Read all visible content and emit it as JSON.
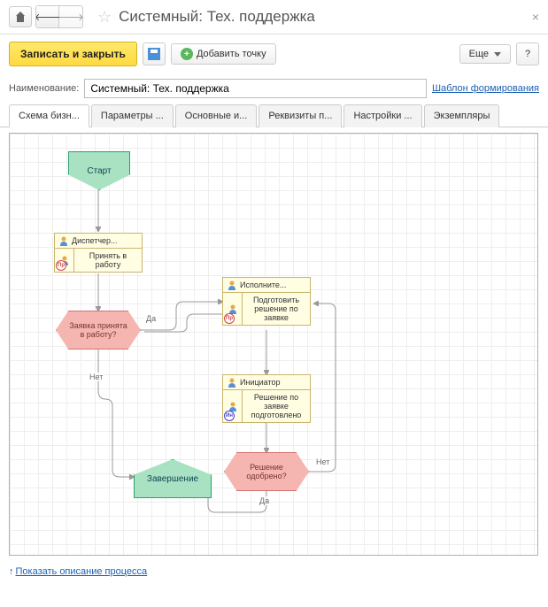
{
  "title": "Системный: Тех. поддержка",
  "toolbar": {
    "save_close": "Записать и закрыть",
    "add_point": "Добавить точку",
    "more": "Еще",
    "help": "?"
  },
  "form": {
    "name_label": "Наименование:",
    "name_value": "Системный: Тех. поддержка",
    "template_link": "Шаблон формирования"
  },
  "tabs": [
    "Схема бизн...",
    "Параметры ...",
    "Основные и...",
    "Реквизиты п...",
    "Настройки ...",
    "Экземпляры"
  ],
  "active_tab": 0,
  "diagram": {
    "start": "Старт",
    "end": "Завершение",
    "task1_role": "Диспетчер...",
    "task1_text": "Принять в работу",
    "task2_role": "Исполните...",
    "task2_text": "Подготовить решение по заявке",
    "task3_role": "Инициатор",
    "task3_text": "Решение по заявке подготовлено",
    "dec1": "Заявка принята в работу?",
    "dec2": "Решение одобрено?",
    "yes": "Да",
    "no": "Нет",
    "badge_pr": "Пр",
    "badge_in": "Ин"
  },
  "footer_link": "Показать описание процесса"
}
